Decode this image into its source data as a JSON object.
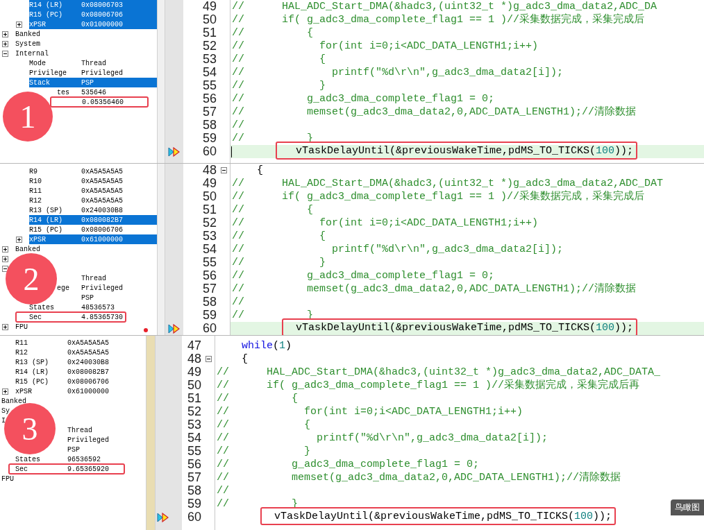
{
  "panels": [
    {
      "badge": "1",
      "registers": [
        {
          "label": "R14 (LR)",
          "value": "0x08006703",
          "selected": true
        },
        {
          "label": "R15 (PC)",
          "value": "0x08006706",
          "selected": true
        },
        {
          "label": "xPSR",
          "value": "0x01000000",
          "selected": true,
          "expanded": false
        }
      ],
      "groups": [
        {
          "label": "Banked",
          "expanded": false,
          "selected": false
        },
        {
          "label": "System",
          "expanded": false,
          "selected": false
        },
        {
          "label": "Internal",
          "expanded": true,
          "selected": false,
          "children": [
            {
              "label": "Mode",
              "value": "Thread",
              "selected": false
            },
            {
              "label": "Privilege",
              "value": "Privileged",
              "selected": false
            },
            {
              "label": "Stack",
              "value": "PSP",
              "selected": true
            },
            {
              "label": "tes",
              "obscured": true,
              "value": "535646",
              "selected": false
            },
            {
              "value": "0.05356460",
              "selected": false,
              "boxed": true
            }
          ]
        }
      ],
      "code": [
        {
          "number": "49",
          "current": false,
          "parts": [
            {
              "text": "//      HAL_ADC_Start_DMA(&hadc3,(uint32_t *)g_adc3_dma_data2,ADC_DA",
              "kind": "comment"
            }
          ]
        },
        {
          "number": "50",
          "current": false,
          "parts": [
            {
              "text": "//      if( g_adc3_dma_complete_flag1 == 1 )//采集数据完成，采集完成后",
              "kind": "comment"
            }
          ]
        },
        {
          "number": "51",
          "current": false,
          "parts": [
            {
              "text": "//          {",
              "kind": "comment"
            }
          ]
        },
        {
          "number": "52",
          "current": false,
          "parts": [
            {
              "text": "//            for(int i=0;i<ADC_DATA_LENGTH1;i++)",
              "kind": "comment"
            }
          ]
        },
        {
          "number": "53",
          "current": false,
          "parts": [
            {
              "text": "//            {",
              "kind": "comment"
            }
          ]
        },
        {
          "number": "54",
          "current": false,
          "parts": [
            {
              "text": "//              printf(\"%d\\r\\n\",g_adc3_dma_data2[i]);",
              "kind": "comment"
            }
          ]
        },
        {
          "number": "55",
          "current": false,
          "parts": [
            {
              "text": "//            }",
              "kind": "comment"
            }
          ]
        },
        {
          "number": "56",
          "current": false,
          "parts": [
            {
              "text": "//          g_adc3_dma_complete_flag1 = 0;",
              "kind": "comment"
            }
          ]
        },
        {
          "number": "57",
          "current": false,
          "parts": [
            {
              "text": "//          memset(g_adc3_dma_data2,0,ADC_DATA_LENGTH1);//清除数据",
              "kind": "comment"
            }
          ]
        },
        {
          "number": "58",
          "current": false,
          "parts": [
            {
              "text": "//",
              "kind": "comment"
            }
          ]
        },
        {
          "number": "59",
          "current": false,
          "parts": [
            {
              "text": "//          }",
              "kind": "comment"
            }
          ]
        },
        {
          "number": "60",
          "current": true,
          "arrow": true,
          "caret": true,
          "boxed": true,
          "parts": [
            {
              "text": "   vTaskDelayUntil(&previousWakeTime,pdMS_TO_TICKS(",
              "kind": "plain"
            },
            {
              "text": "100",
              "kind": "number"
            },
            {
              "text": "));",
              "kind": "plain"
            }
          ]
        }
      ]
    },
    {
      "badge": "2",
      "cursor_dot": true,
      "registers": [
        {
          "label": "R9",
          "value": "0xA5A5A5A5",
          "selected": false
        },
        {
          "label": "R10",
          "value": "0xA5A5A5A5",
          "selected": false
        },
        {
          "label": "R11",
          "value": "0xA5A5A5A5",
          "selected": false
        },
        {
          "label": "R12",
          "value": "0xA5A5A5A5",
          "selected": false
        },
        {
          "label": "R13 (SP)",
          "value": "0x240030B8",
          "selected": false
        },
        {
          "label": "R14 (LR)",
          "value": "0x080082B7",
          "selected": true
        },
        {
          "label": "R15 (PC)",
          "value": "0x08006706",
          "selected": false
        },
        {
          "label": "xPSR",
          "value": "0x61000000",
          "selected": true,
          "expanded": false
        }
      ],
      "groups": [
        {
          "label": "Banked",
          "expanded": false,
          "selected": false
        },
        {
          "expanded": false
        },
        {
          "expanded": true,
          "children": [
            {
              "value": "Thread",
              "selected": false
            },
            {
              "label": "ege",
              "obscured": true,
              "value": "Privileged",
              "selected": false
            },
            {
              "value": "PSP",
              "selected": false
            },
            {
              "label": "States",
              "value": "48536573",
              "selected": false
            },
            {
              "label": "Sec",
              "value": "4.85365730",
              "selected": false,
              "boxed": true
            }
          ]
        },
        {
          "label": "FPU",
          "expanded": false,
          "selected": false
        }
      ],
      "code": [
        {
          "number": "48",
          "current": false,
          "fold": true,
          "parts": [
            {
              "text": "    {",
              "kind": "plain"
            }
          ]
        },
        {
          "number": "49",
          "current": false,
          "parts": [
            {
              "text": "//      HAL_ADC_Start_DMA(&hadc3,(uint32_t *)g_adc3_dma_data2,ADC_DAT",
              "kind": "comment"
            }
          ]
        },
        {
          "number": "50",
          "current": false,
          "parts": [
            {
              "text": "//      if( g_adc3_dma_complete_flag1 == 1 )//采集数据完成，采集完成后",
              "kind": "comment"
            }
          ]
        },
        {
          "number": "51",
          "current": false,
          "parts": [
            {
              "text": "//          {",
              "kind": "comment"
            }
          ]
        },
        {
          "number": "52",
          "current": false,
          "parts": [
            {
              "text": "//            for(int i=0;i<ADC_DATA_LENGTH1;i++)",
              "kind": "comment"
            }
          ]
        },
        {
          "number": "53",
          "current": false,
          "parts": [
            {
              "text": "//            {",
              "kind": "comment"
            }
          ]
        },
        {
          "number": "54",
          "current": false,
          "parts": [
            {
              "text": "//              printf(\"%d\\r\\n\",g_adc3_dma_data2[i]);",
              "kind": "comment"
            }
          ]
        },
        {
          "number": "55",
          "current": false,
          "parts": [
            {
              "text": "//            }",
              "kind": "comment"
            }
          ]
        },
        {
          "number": "56",
          "current": false,
          "parts": [
            {
              "text": "//          g_adc3_dma_complete_flag1 = 0;",
              "kind": "comment"
            }
          ]
        },
        {
          "number": "57",
          "current": false,
          "parts": [
            {
              "text": "//          memset(g_adc3_dma_data2,0,ADC_DATA_LENGTH1);//清除数据",
              "kind": "comment"
            }
          ]
        },
        {
          "number": "58",
          "current": false,
          "parts": [
            {
              "text": "//",
              "kind": "comment"
            }
          ]
        },
        {
          "number": "59",
          "current": false,
          "parts": [
            {
              "text": "//          }",
              "kind": "comment"
            }
          ]
        },
        {
          "number": "60",
          "current": true,
          "arrow": true,
          "boxed": true,
          "parts": [
            {
              "text": "  vTaskDelayUntil(&previousWakeTime,pdMS_TO_TICKS(",
              "kind": "plain"
            },
            {
              "text": "100",
              "kind": "number"
            },
            {
              "text": "));",
              "kind": "plain"
            }
          ]
        }
      ]
    },
    {
      "badge": "3",
      "tooltip": "鸟瞰图",
      "registers": [
        {
          "label": "R11",
          "value": "0xA5A5A5A5",
          "selected": false
        },
        {
          "label": "R12",
          "value": "0xA5A5A5A5",
          "selected": false
        },
        {
          "label": "R13 (SP)",
          "value": "0x240030B8",
          "selected": false
        },
        {
          "label": "R14 (LR)",
          "value": "0x080082B7",
          "selected": false
        },
        {
          "label": "R15 (PC)",
          "value": "0x08006706",
          "selected": false
        },
        {
          "label": "xPSR",
          "value": "0x61000000",
          "selected": false,
          "expanded": false
        }
      ],
      "groups": [
        {
          "label": "Banked",
          "selected": false
        },
        {
          "label": "Sy",
          "selected": false
        },
        {
          "label": "I",
          "selected": false,
          "children": [
            {
              "value": "Thread",
              "selected": false
            },
            {
              "value": "Privileged",
              "selected": false
            },
            {
              "value": "PSP",
              "selected": false
            },
            {
              "label": "States",
              "value": "96536592",
              "selected": false
            },
            {
              "label": "Sec",
              "value": "9.65365920",
              "selected": false,
              "boxed": true
            }
          ]
        },
        {
          "label": "FPU",
          "selected": false
        }
      ],
      "code": [
        {
          "number": "47",
          "current": false,
          "parts": [
            {
              "text": "    while",
              "kind": "keyword"
            },
            {
              "text": "(",
              "kind": "plain"
            },
            {
              "text": "1",
              "kind": "number"
            },
            {
              "text": ")",
              "kind": "plain"
            }
          ]
        },
        {
          "number": "48",
          "current": false,
          "fold": true,
          "parts": [
            {
              "text": "    {",
              "kind": "plain"
            }
          ]
        },
        {
          "number": "49",
          "current": false,
          "parts": [
            {
              "text": "//      HAL_ADC_Start_DMA(&hadc3,(uint32_t *)g_adc3_dma_data2,ADC_DATA_",
              "kind": "comment"
            }
          ]
        },
        {
          "number": "50",
          "current": false,
          "parts": [
            {
              "text": "//      if( g_adc3_dma_complete_flag1 == 1 )//采集数据完成，采集完成后再",
              "kind": "comment"
            }
          ]
        },
        {
          "number": "51",
          "current": false,
          "parts": [
            {
              "text": "//          {",
              "kind": "comment"
            }
          ]
        },
        {
          "number": "52",
          "current": false,
          "parts": [
            {
              "text": "//            for(int i=0;i<ADC_DATA_LENGTH1;i++)",
              "kind": "comment"
            }
          ]
        },
        {
          "number": "53",
          "current": false,
          "parts": [
            {
              "text": "//            {",
              "kind": "comment"
            }
          ]
        },
        {
          "number": "54",
          "current": false,
          "parts": [
            {
              "text": "//              printf(\"%d\\r\\n\",g_adc3_dma_data2[i]);",
              "kind": "comment"
            }
          ]
        },
        {
          "number": "55",
          "current": false,
          "parts": [
            {
              "text": "//            }",
              "kind": "comment"
            }
          ]
        },
        {
          "number": "56",
          "current": false,
          "parts": [
            {
              "text": "//          g_adc3_dma_complete_flag1 = 0;",
              "kind": "comment"
            }
          ]
        },
        {
          "number": "57",
          "current": false,
          "parts": [
            {
              "text": "//          memset(g_adc3_dma_data2,0,ADC_DATA_LENGTH1);//清除数据",
              "kind": "comment"
            }
          ]
        },
        {
          "number": "58",
          "current": false,
          "parts": [
            {
              "text": "//",
              "kind": "comment"
            }
          ]
        },
        {
          "number": "59",
          "current": false,
          "parts": [
            {
              "text": "//          }",
              "kind": "comment"
            }
          ]
        },
        {
          "number": "60",
          "current": false,
          "arrow": true,
          "boxed": true,
          "parts": [
            {
              "text": "  vTaskDelayUntil(&previousWakeTime,pdMS_TO_TICKS(",
              "kind": "plain"
            },
            {
              "text": "100",
              "kind": "number"
            },
            {
              "text": "));",
              "kind": "plain"
            }
          ]
        }
      ]
    }
  ]
}
